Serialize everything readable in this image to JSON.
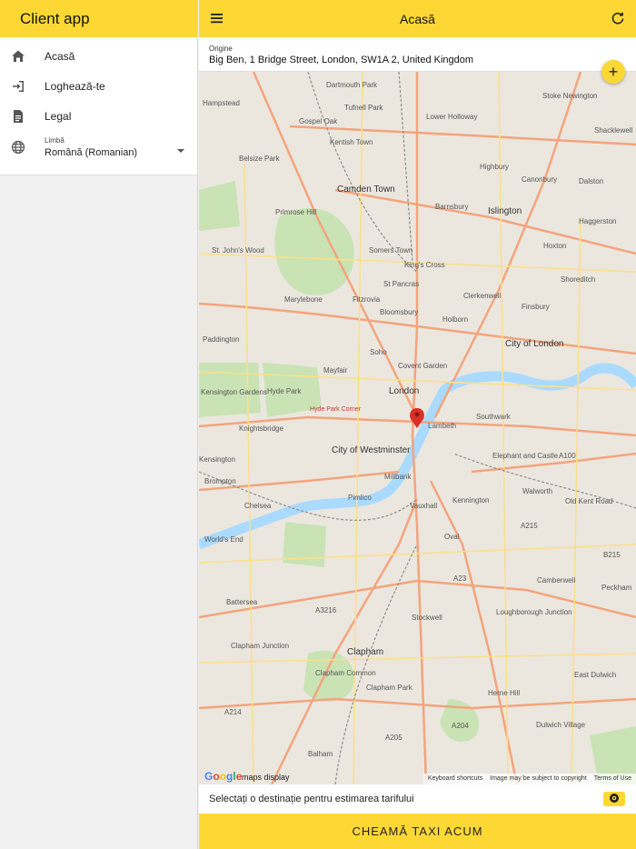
{
  "drawer": {
    "title": "Client app",
    "items": [
      {
        "label": "Acasă",
        "icon": "home-icon"
      },
      {
        "label": "Loghează-te",
        "icon": "login-icon"
      },
      {
        "label": "Legal",
        "icon": "document-icon"
      }
    ],
    "language": {
      "label": "Limbă",
      "value": "Română (Romanian)",
      "icon": "globe-icon"
    }
  },
  "header": {
    "title": "Acasă"
  },
  "origin": {
    "label": "Origine",
    "value": "Big Ben, 1 Bridge Street, London, SW1A 2, United Kingdom"
  },
  "map": {
    "labels": {
      "hampstead": "Hampstead",
      "dartmouth_park": "Dartmouth Park",
      "tufnell_park": "Tufnell Park",
      "gospel_oak": "Gospel Oak",
      "lower_holloway": "Lower Holloway",
      "stoke_newington": "Stoke Newington",
      "shacklewell": "Shacklewell",
      "kentish_town": "Kentish Town",
      "belsize_park": "Belsize Park",
      "highbury": "Highbury",
      "canonbury": "Canonbury",
      "dalston": "Dalston",
      "camden_town": "Camden Town",
      "barnsbury": "Barnsbury",
      "islington": "Islington",
      "haggerston": "Haggerston",
      "primrose_hill": "Primrose Hill",
      "st_johns_wood": "St. John's Wood",
      "somers_town": "Somers Town",
      "kings_cross": "King's Cross",
      "hoxton": "Hoxton",
      "shoreditch": "Shoreditch",
      "marylebone": "Marylebone",
      "fitzrovia": "Fitzrovia",
      "st_pancras": "St Pancras",
      "clerkenwell": "Clerkenwell",
      "finsbury": "Finsbury",
      "bloomsbury": "Bloomsbury",
      "paddington": "Paddington",
      "holborn": "Holborn",
      "city_of_london": "City of London",
      "soho": "Soho",
      "mayfair": "Mayfair",
      "covent_garden": "Covent Garden",
      "london": "London",
      "hyde_park": "Hyde Park",
      "kensington_gardens": "Kensington Gardens",
      "hyde_park_corner": "Hyde Park Corner",
      "knightsbridge": "Knightsbridge",
      "lambeth": "Lambeth",
      "southwark": "Southwark",
      "city_of_westminster": "City of Westminster",
      "kensington": "Kensington",
      "elephant_castle": "Elephant and Castle",
      "a100": "A100",
      "millbank": "Millbank",
      "brompton": "Brompton",
      "walworth": "Walworth",
      "chelsea": "Chelsea",
      "pimlico": "Pimlico",
      "vauxhall": "Vauxhall",
      "kennington": "Kennington",
      "old_kent_road": "Old Kent Road",
      "a215": "A215",
      "worlds_end": "World's End",
      "oval": "Oval",
      "b215": "B215",
      "a23": "A23",
      "camberwell": "Camberwell",
      "peckham": "Peckham",
      "battersea": "Battersea",
      "a3216": "A3216",
      "stockwell": "Stockwell",
      "loughborough_junction": "Loughborough Junction",
      "clapham_junction": "Clapham Junction",
      "clapham": "Clapham",
      "clapham_common": "Clapham Common",
      "east_dulwich": "East Dulwich",
      "clapham_park": "Clapham Park",
      "herne_hill": "Herne Hill",
      "a214": "A214",
      "a204": "A204",
      "dulwich_village": "Dulwich Village",
      "a205": "A205",
      "balham": "Balham"
    },
    "maps_display": "maps display",
    "google": [
      "G",
      "o",
      "o",
      "g",
      "l",
      "e"
    ],
    "footer": {
      "keyboard": "Keyboard shortcuts",
      "copyright": "Image may be subject to copyright",
      "terms": "Terms of Use"
    },
    "pin_color": "#d93025"
  },
  "destination": {
    "prompt": "Selectați o destinație pentru estimarea tarifului"
  },
  "call_button": {
    "label": "CHEAMĂ TAXI ACUM"
  },
  "colors": {
    "accent": "#fdd835",
    "drawer_bg": "#f1f1f1"
  }
}
